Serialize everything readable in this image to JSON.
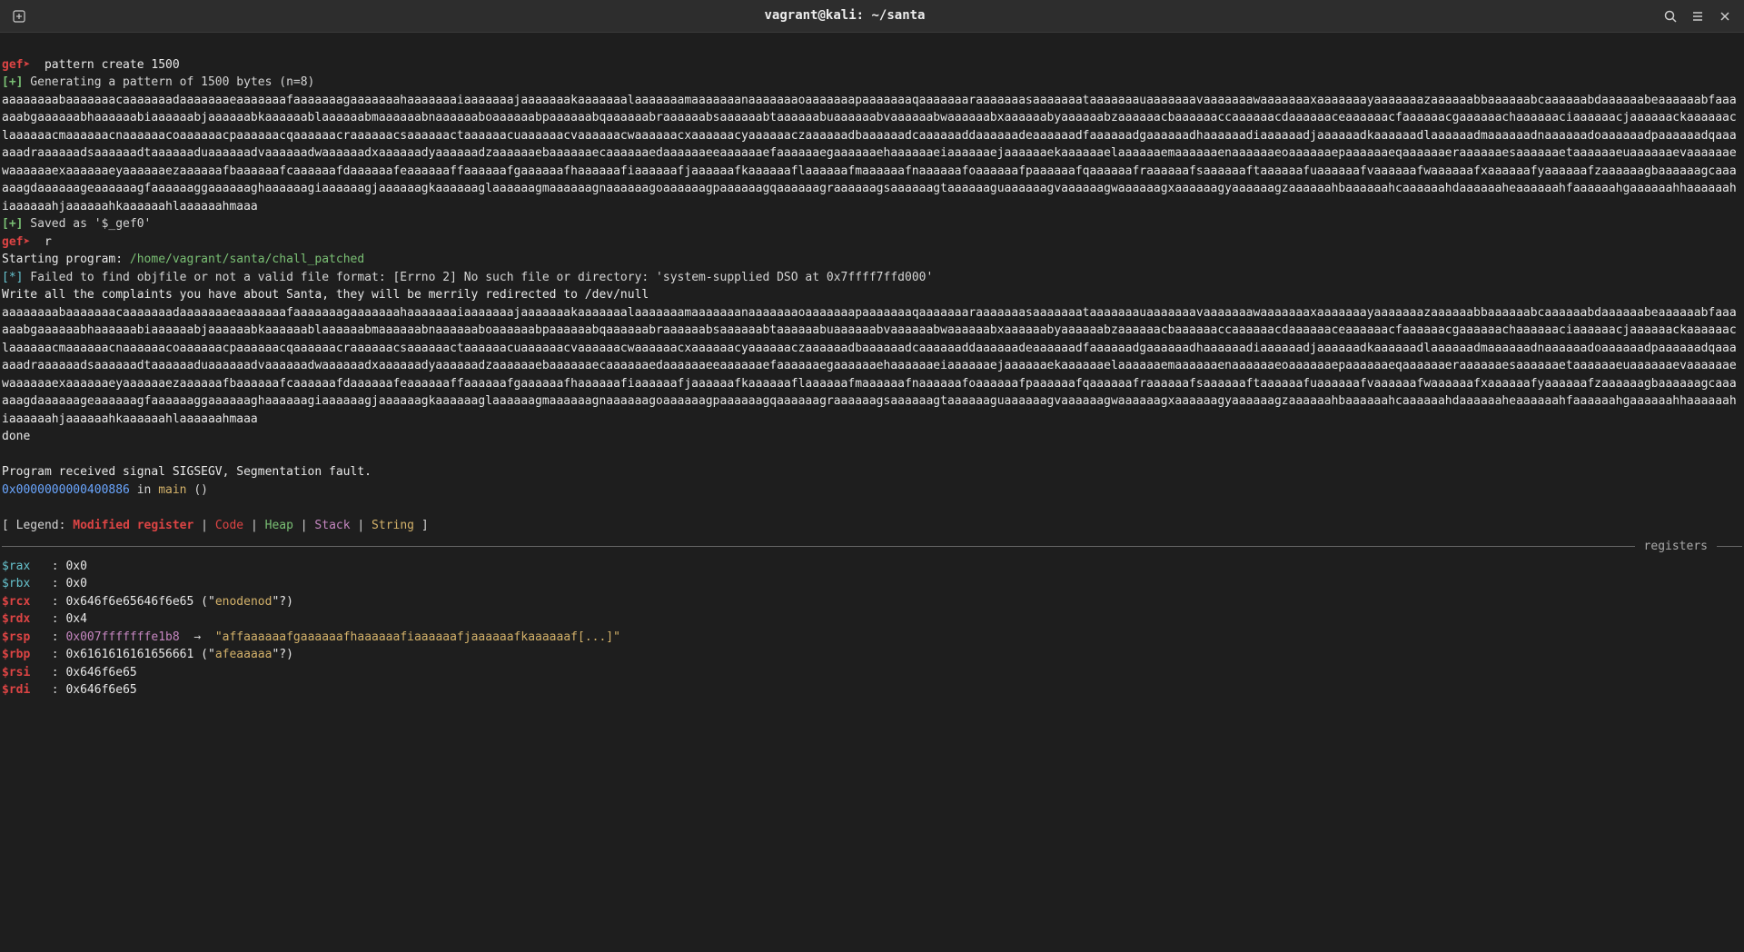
{
  "titlebar": {
    "title": "vagrant@kali: ~/santa"
  },
  "cmd1": {
    "prompt": "gef➤",
    "cmd": "  pattern create 1500"
  },
  "gen_prefix": "[+]",
  "gen_text": " Generating a pattern of 1500 bytes (n=8)",
  "pattern": "aaaaaaaabaaaaaaacaaaaaaadaaaaaaaeaaaaaaafaaaaaaagaaaaaaahaaaaaaaiaaaaaaajaaaaaaakaaaaaaalaaaaaaamaaaaaaanaaaaaaaoaaaaaaapaaaaaaaqaaaaaaaraaaaaaasaaaaaaataaaaaaauaaaaaaavaaaaaaawaaaaaaaxaaaaaaayaaaaaaazaaaaaabbaaaaaabcaaaaaabdaaaaaabeaaaaaabfaaaaaabgaaaaaabhaaaaaabiaaaaaabjaaaaaabkaaaaaablaaaaaabmaaaaaabnaaaaaaboaaaaaabpaaaaaabqaaaaaabraaaaaabsaaaaaabtaaaaaabuaaaaaabvaaaaaabwaaaaaabxaaaaaabyaaaaaabzaaaaaacbaaaaaaccaaaaaacdaaaaaaceaaaaaacfaaaaaacgaaaaaachaaaaaaciaaaaaacjaaaaaackaaaaaaclaaaaaacmaaaaaacnaaaaaacoaaaaaacpaaaaaacqaaaaaacraaaaaacsaaaaaactaaaaaacuaaaaaacvaaaaaacwaaaaaacxaaaaaacyaaaaaaczaaaaaadbaaaaaadcaaaaaaddaaaaaadeaaaaaadfaaaaaadgaaaaaadhaaaaaadiaaaaaadjaaaaaadkaaaaaadlaaaaaadmaaaaaadnaaaaaadoaaaaaadpaaaaaadqaaaaaadraaaaaadsaaaaaadtaaaaaaduaaaaaadvaaaaaadwaaaaaadxaaaaaadyaaaaaadzaaaaaaebaaaaaaecaaaaaaedaaaaaaeeaaaaaaefaaaaaaegaaaaaaehaaaaaaeiaaaaaaejaaaaaaekaaaaaaelaaaaaaemaaaaaaenaaaaaaeoaaaaaaepaaaaaaeqaaaaaaeraaaaaaesaaaaaaetaaaaaaeuaaaaaaevaaaaaaewaaaaaaexaaaaaaeyaaaaaaezaaaaaafbaaaaaafcaaaaaafdaaaaaafeaaaaaaffaaaaaafgaaaaaafhaaaaaafiaaaaaafjaaaaaafkaaaaaaflaaaaaafmaaaaaafnaaaaaafoaaaaaafpaaaaaafqaaaaaafraaaaaafsaaaaaaftaaaaaafuaaaaaafvaaaaaafwaaaaaafxaaaaaafyaaaaaafzaaaaaagbaaaaaagcaaaaaagdaaaaaageaaaaaagfaaaaaaggaaaaaaghaaaaaagiaaaaaagjaaaaaagkaaaaaaglaaaaaagmaaaaaagnaaaaaagoaaaaaagpaaaaaagqaaaaaagraaaaaagsaaaaaagtaaaaaaguaaaaaagvaaaaaagwaaaaaagxaaaaaagyaaaaaagzaaaaaahbaaaaaahcaaaaaahdaaaaaaheaaaaaahfaaaaaahgaaaaaahhaaaaaahiaaaaaahjaaaaaahkaaaaaahlaaaaaahmaaa",
  "saved_prefix": "[+]",
  "saved_text": " Saved as '$_gef0'",
  "cmd2": {
    "prompt": "gef➤",
    "cmd": "  r"
  },
  "start_prog": "Starting program: ",
  "prog_path": "/home/vagrant/santa/chall_patched",
  "fail_prefix": "[*]",
  "fail_text": " Failed to find objfile or not a valid file format: [Errno 2] No such file or directory: 'system-supplied DSO at 0x7ffff7ffd000'",
  "write_text": "Write all the complaints you have about Santa, they will be merrily redirected to /dev/null",
  "done": "done",
  "sigsegv": "Program received signal SIGSEGV, Segmentation fault.",
  "addr": "0x0000000000400886",
  "in_text": " in ",
  "main_text": "main",
  "parens": " ()",
  "legend": {
    "open": "[ Legend: ",
    "modified": "Modified register",
    "code": "Code",
    "heap": "Heap",
    "stack": "Stack",
    "string": "String",
    "sep": " | ",
    "close": " ]"
  },
  "section": {
    "registers": "registers"
  },
  "regs": {
    "rax": {
      "name": "$rax",
      "sep": "   : ",
      "val": "0x0"
    },
    "rbx": {
      "name": "$rbx",
      "sep": "   : ",
      "val": "0x0"
    },
    "rcx": {
      "name": "$rcx",
      "sep": "   : ",
      "val": "0x646f6e65646f6e65 (\"",
      "str": "enodenod",
      "tail": "\"?)"
    },
    "rdx": {
      "name": "$rdx",
      "sep": "   : ",
      "val": "0x4"
    },
    "rsp": {
      "name": "$rsp",
      "sep": "   : ",
      "addr": "0x007fffffffe1b8",
      "arrow": "  →  ",
      "str": "\"affaaaaaafgaaaaaafhaaaaaafiaaaaaafjaaaaaafkaaaaaaf[...]\""
    },
    "rbp": {
      "name": "$rbp",
      "sep": "   : ",
      "val": "0x6161616161656661 (\"",
      "str": "afeaaaaa",
      "tail": "\"?)"
    },
    "rsi": {
      "name": "$rsi",
      "sep": "   : ",
      "val": "0x646f6e65"
    },
    "rdi": {
      "name": "$rdi",
      "sep": "   : ",
      "val": "0x646f6e65"
    }
  }
}
